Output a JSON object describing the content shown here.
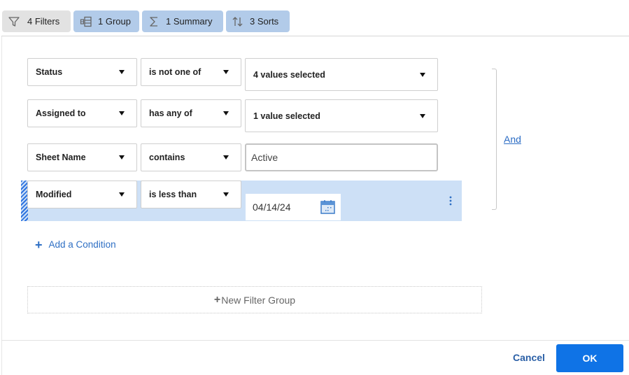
{
  "toolbar": {
    "filters": {
      "label": "4 Filters",
      "icon": "filter-icon"
    },
    "group": {
      "label": "1 Group",
      "icon": "group-icon"
    },
    "summary": {
      "label": "1 Summary",
      "icon": "sigma-icon"
    },
    "sorts": {
      "label": "3 Sorts",
      "icon": "sort-icon"
    }
  },
  "conditions": [
    {
      "field": "Status",
      "operator": "is not one of",
      "value": "4 values selected",
      "value_type": "multiselect"
    },
    {
      "field": "Assigned to",
      "operator": "has any of",
      "value": "1 value selected",
      "value_type": "multiselect"
    },
    {
      "field": "Sheet Name",
      "operator": "contains",
      "value": "Active",
      "value_type": "text"
    },
    {
      "field": "Modified",
      "operator": "is less than",
      "value": "04/14/24",
      "value_type": "date",
      "selected": true
    }
  ],
  "logic": {
    "label": "And"
  },
  "add_condition": {
    "label": "Add a Condition"
  },
  "new_filter_group": {
    "label": "New Filter Group"
  },
  "footer": {
    "cancel_label": "Cancel",
    "ok_label": "OK"
  },
  "colors": {
    "accent": "#0f73e6",
    "link": "#2b6cc4",
    "active_toolbar": "#b2cbe9",
    "selected_row": "#cde0f6"
  }
}
